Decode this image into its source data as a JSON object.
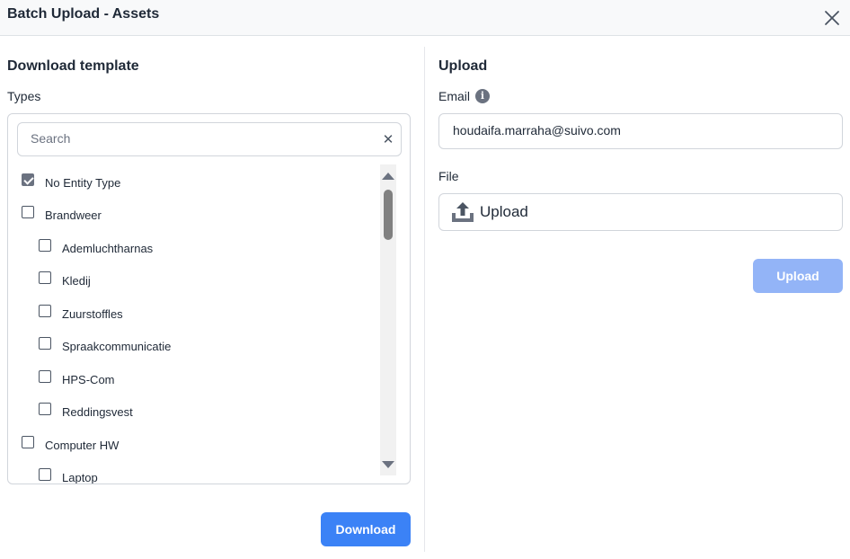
{
  "dialog": {
    "title": "Batch Upload - Assets",
    "close_icon": "close-icon"
  },
  "download": {
    "section_title": "Download template",
    "types_label": "Types",
    "search_placeholder": "Search",
    "search_clear": "✕",
    "items": [
      {
        "label": "No Entity Type",
        "checked": true,
        "level": 0
      },
      {
        "label": "Brandweer",
        "checked": false,
        "level": 0
      },
      {
        "label": "Ademluchtharnas",
        "checked": false,
        "level": 1
      },
      {
        "label": "Kledij",
        "checked": false,
        "level": 1
      },
      {
        "label": "Zuurstoffles",
        "checked": false,
        "level": 1
      },
      {
        "label": "Spraakcommunicatie",
        "checked": false,
        "level": 1
      },
      {
        "label": "HPS-Com",
        "checked": false,
        "level": 1
      },
      {
        "label": "Reddingsvest",
        "checked": false,
        "level": 1
      },
      {
        "label": "Computer HW",
        "checked": false,
        "level": 0
      },
      {
        "label": "Laptop",
        "checked": false,
        "level": 1
      }
    ],
    "button_label": "Download"
  },
  "upload": {
    "section_title": "Upload",
    "email_label": "Email",
    "info_icon_text": "i",
    "email_value": "houdaifa.marraha@suivo.com",
    "file_label": "File",
    "file_button_label": "Upload",
    "file_icon": "upload-icon",
    "button_label": "Upload",
    "button_disabled": true
  },
  "colors": {
    "primary": "#3b82f6",
    "primary_disabled": "#93b4f7",
    "header_bg": "#f8f9fa"
  }
}
